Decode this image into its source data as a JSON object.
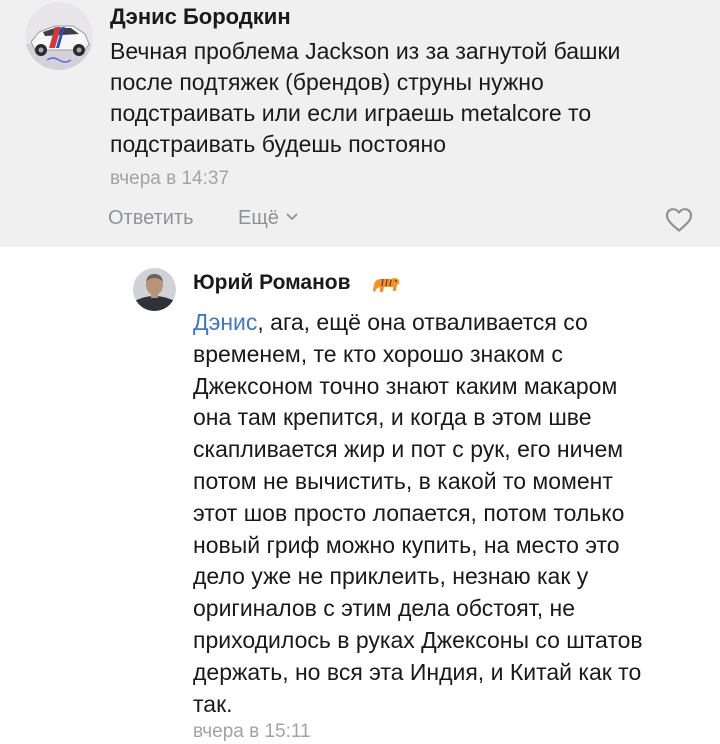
{
  "comments": [
    {
      "author": "Дэнис Бородкин",
      "text_lines": [
        "Вечная проблема Jackson из за загнутой башки",
        "после подтяжек (брендов) струны нужно",
        "подстраивать или если играешь metalcore то",
        "подстраивать будешь постояно"
      ],
      "time": "вчера в 14:37",
      "reply_label": "Ответить",
      "more_label": "Ещё",
      "avatar_icon": "car-avatar"
    },
    {
      "author": "Юрий Романов",
      "author_emoji": "tiger-emoji",
      "mention": "Дэнис",
      "first_line_rest": ", ага, ещё она отваливается со",
      "text_lines": [
        "временем, те кто хорошо знаком с",
        "Джексоном точно знают каким макаром",
        "она там крепится, и когда в этом шве",
        "скапливается жир и пот с рук, его ничем",
        "потом не вычистить, в какой то момент",
        "этот шов просто лопается, потом только",
        "новый гриф можно купить, на место это",
        "дело уже не приклеить, незнаю как у",
        "оригиналов с этим дела обстоят, не",
        "приходилось в руках Джексоны со штатов",
        "держать, но вся эта Индия, и Китай как то",
        "так."
      ],
      "time": "вчера в 15:11",
      "avatar_icon": "person-avatar"
    }
  ],
  "colors": {
    "mention": "#3f78c4",
    "secondary_text": "#a0a4a8",
    "comment1_bg": "#f0f0f0"
  }
}
